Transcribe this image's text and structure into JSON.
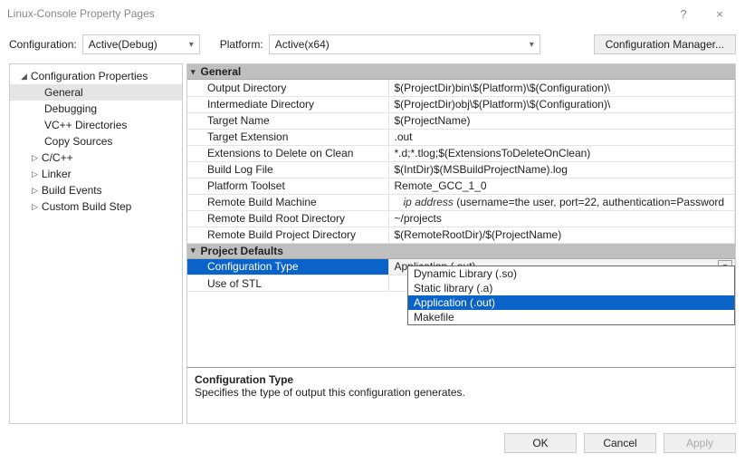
{
  "window": {
    "title": "Linux-Console Property Pages",
    "help": "?",
    "close": "×"
  },
  "topbar": {
    "config_label": "Configuration:",
    "config_value": "Active(Debug)",
    "platform_label": "Platform:",
    "platform_value": "Active(x64)",
    "cfg_mgr": "Configuration Manager..."
  },
  "tree": {
    "root": "Configuration Properties",
    "items": [
      "General",
      "Debugging",
      "VC++ Directories",
      "Copy Sources",
      "C/C++",
      "Linker",
      "Build Events",
      "Custom Build Step"
    ]
  },
  "sections": {
    "general": "General",
    "defaults": "Project Defaults"
  },
  "rows": {
    "g": [
      {
        "k": "Output Directory",
        "v": "$(ProjectDir)bin\\$(Platform)\\$(Configuration)\\"
      },
      {
        "k": "Intermediate Directory",
        "v": "$(ProjectDir)obj\\$(Platform)\\$(Configuration)\\"
      },
      {
        "k": "Target Name",
        "v": "$(ProjectName)"
      },
      {
        "k": "Target Extension",
        "v": ".out"
      },
      {
        "k": "Extensions to Delete on Clean",
        "v": "*.d;*.tlog;$(ExtensionsToDeleteOnClean)"
      },
      {
        "k": "Build Log File",
        "v": "$(IntDir)$(MSBuildProjectName).log"
      },
      {
        "k": "Platform Toolset",
        "v": "Remote_GCC_1_0"
      },
      {
        "k": "Remote Build Machine",
        "v_ip": "ip address",
        "v_tail": "   (username=the user, port=22, authentication=Password"
      },
      {
        "k": "Remote Build Root Directory",
        "v": "~/projects"
      },
      {
        "k": "Remote Build Project Directory",
        "v": "$(RemoteRootDir)/$(ProjectName)"
      }
    ],
    "d": [
      {
        "k": "Configuration Type",
        "v": "Application (.out)"
      },
      {
        "k": "Use of STL",
        "v": ""
      }
    ]
  },
  "dropdown": [
    "Dynamic Library (.so)",
    "Static library (.a)",
    "Application (.out)",
    "Makefile"
  ],
  "desc": {
    "t": "Configuration Type",
    "b": "Specifies the type of output this configuration generates."
  },
  "buttons": {
    "ok": "OK",
    "cancel": "Cancel",
    "apply": "Apply"
  }
}
